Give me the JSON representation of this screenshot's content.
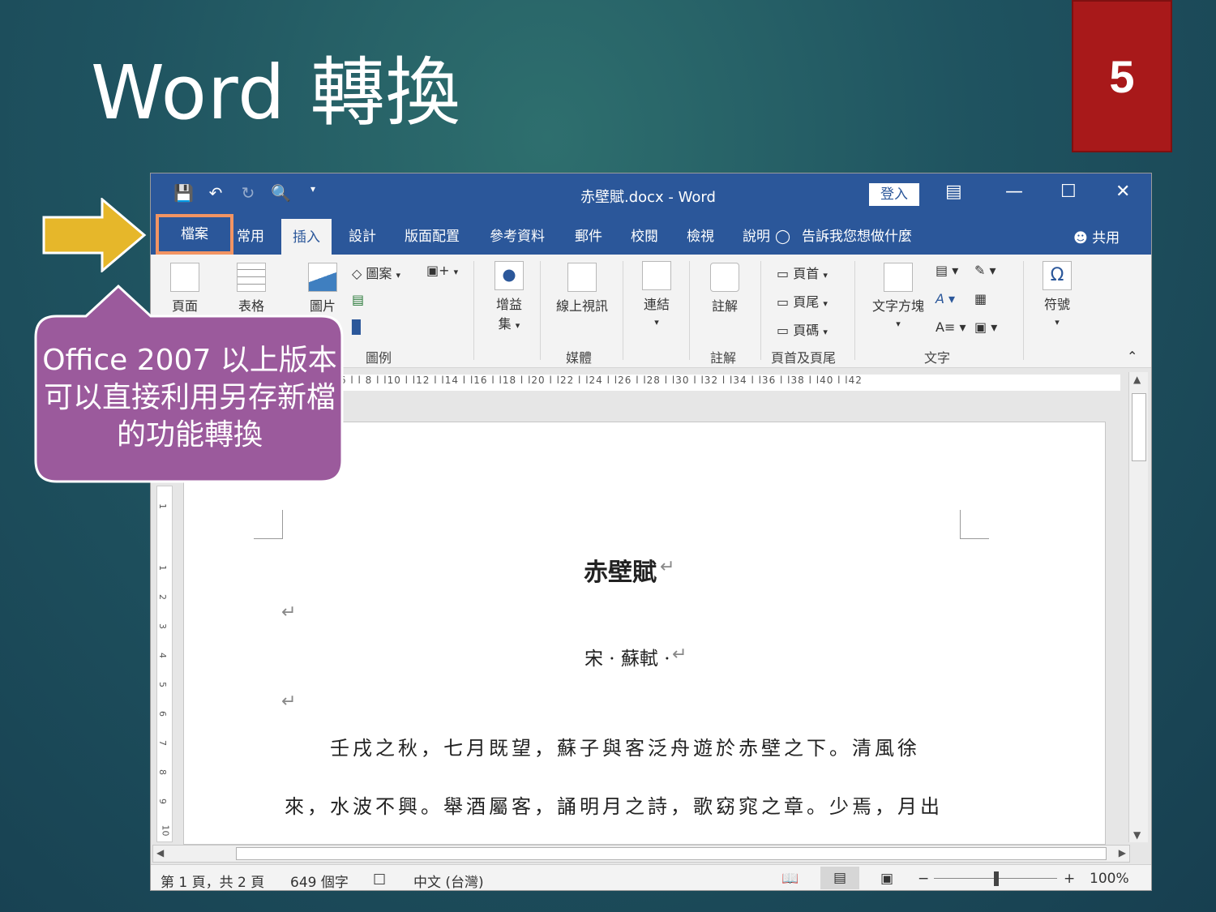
{
  "slide": {
    "title": "Word 轉換",
    "page_number": "5",
    "callout_text": "Office 2007 以上版本可以直接利用另存新檔的功能轉換"
  },
  "word": {
    "window_title": "赤壁賦.docx  -  Word",
    "login_label": "登入",
    "tabs": {
      "file": "檔案",
      "home": "常用",
      "insert": "插入",
      "design": "設計",
      "layout": "版面配置",
      "references": "參考資料",
      "mailings": "郵件",
      "review": "校閱",
      "view": "檢視",
      "help": "說明"
    },
    "tell_me": "告訴我您想做什麼",
    "share": "共用",
    "ribbon": {
      "pages": "頁面",
      "table": "表格",
      "pictures": "圖片",
      "shapes": "圖案",
      "addins": "增益",
      "addins2": "集",
      "online_video": "線上視訊",
      "links": "連結",
      "comment": "註解",
      "header": "頁首",
      "footer": "頁尾",
      "page_number": "頁碼",
      "textbox": "文字方塊",
      "symbols": "符號",
      "group_illustrations": "圖例",
      "group_media": "媒體",
      "group_comments": "註解",
      "group_header_footer": "頁首及頁尾",
      "group_text": "文字"
    },
    "ruler_text": "l 4 l   l 6 l   l 8 l   l10 l   l12 l   l14 l   l16 l   l18 l   l20 l   l22 l   l24 l   l26 l   l28 l   l30 l   l32 l   l34 l   l36 l   l38 l   l40 l   l42",
    "vruler_labels": [
      "1",
      "1",
      "2",
      "3",
      "4",
      "5",
      "6",
      "7",
      "8",
      "9",
      "10"
    ],
    "document": {
      "title": "赤壁賦",
      "author": "宋 · 蘇軾 ·",
      "line1": "壬戌之秋，七月既望，蘇子與客泛舟遊於赤壁之下。清風徐",
      "line2": "來，水波不興。舉酒屬客，誦明月之詩，歌窈窕之章。少焉，月出"
    },
    "status": {
      "page": "第 1 頁，共 2 頁",
      "words": "649 個字",
      "language": "中文 (台灣)",
      "zoom": "100%",
      "zoom_minus": "−",
      "zoom_plus": "+"
    }
  },
  "colors": {
    "word_blue": "#2b579a",
    "highlight_orange": "#f29463",
    "callout_purple": "#9b5a9c",
    "arrow_yellow": "#e6b72a",
    "page_num_red": "#a8191a"
  }
}
